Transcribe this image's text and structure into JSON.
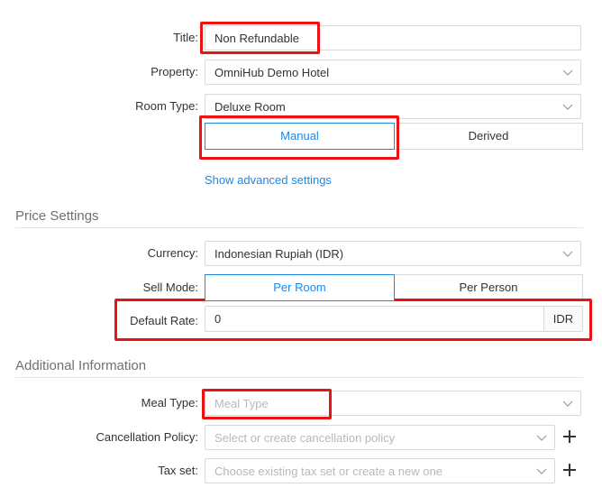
{
  "form": {
    "title_label": "Title:",
    "title_value": "Non Refundable",
    "property_label": "Property:",
    "property_value": "OmniHub Demo Hotel",
    "room_type_label": "Room Type:",
    "room_type_value": "Deluxe Room",
    "rate_mode_options": [
      "Manual",
      "Derived"
    ],
    "rate_mode_selected": "Manual",
    "advanced_link": "Show advanced settings"
  },
  "price_settings": {
    "heading": "Price Settings",
    "currency_label": "Currency:",
    "currency_value": "Indonesian Rupiah (IDR)",
    "sell_mode_label": "Sell Mode:",
    "sell_mode_options": [
      "Per Room",
      "Per Person"
    ],
    "sell_mode_selected": "Per Room",
    "default_rate_label": "Default Rate:",
    "default_rate_value": "0",
    "default_rate_suffix": "IDR"
  },
  "additional": {
    "heading": "Additional Information",
    "meal_type_label": "Meal Type:",
    "meal_type_placeholder": "Meal Type",
    "cancellation_label": "Cancellation Policy:",
    "cancellation_placeholder": "Select or create cancellation policy",
    "tax_label": "Tax set:",
    "tax_placeholder": "Choose existing tax set or create a new one"
  },
  "colors": {
    "accent": "#1e88e5",
    "highlight": "#ee1111",
    "border": "#d9d9d9"
  },
  "icons": [
    "chevron-down-icon",
    "plus-icon"
  ]
}
